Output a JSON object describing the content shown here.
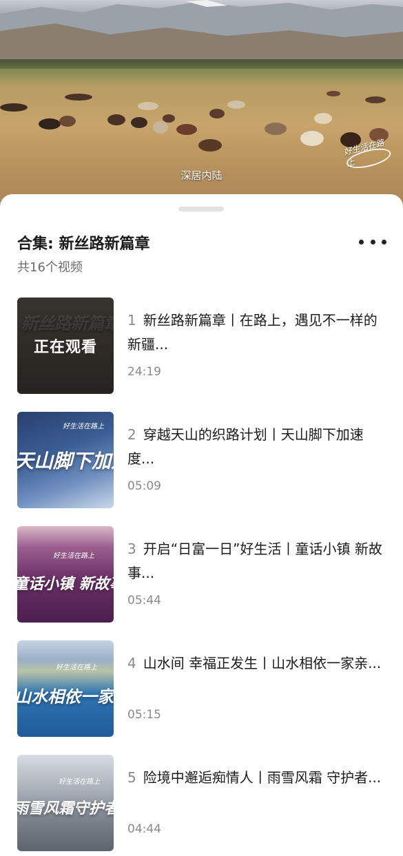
{
  "video": {
    "caption": "深居内陆",
    "logo_text": "好生活在路上"
  },
  "collection": {
    "title": "合集: 新丝路新篇章",
    "count": "共16个视频",
    "now_playing": "正在观看",
    "items": [
      {
        "num": "1",
        "title": "新丝路新篇章丨在路上，遇见不一样的新疆...",
        "duration": "24:19",
        "thumb_text": "新丝路新篇章"
      },
      {
        "num": "2",
        "title": "穿越天山的织路计划丨天山脚下加速度...",
        "duration": "05:09",
        "thumb_text": "天山脚下加速度",
        "thumb_logo": "好生活在路上"
      },
      {
        "num": "3",
        "title": "开启“日富一日”好生活丨童话小镇 新故事...",
        "duration": "05:44",
        "thumb_text": "童话小镇 新故事",
        "thumb_logo": "好生活在路上"
      },
      {
        "num": "4",
        "title": "山水间 幸福正发生丨山水相依一家亲...",
        "duration": "05:15",
        "thumb_text": "山水相依一家亲",
        "thumb_logo": "好生活在路上"
      },
      {
        "num": "5",
        "title": "险境中邂逅痴情人丨雨雪风霜 守护者...",
        "duration": "04:44",
        "thumb_text": "雨雪风霜守护者",
        "thumb_logo": "好生活在路上"
      }
    ]
  }
}
